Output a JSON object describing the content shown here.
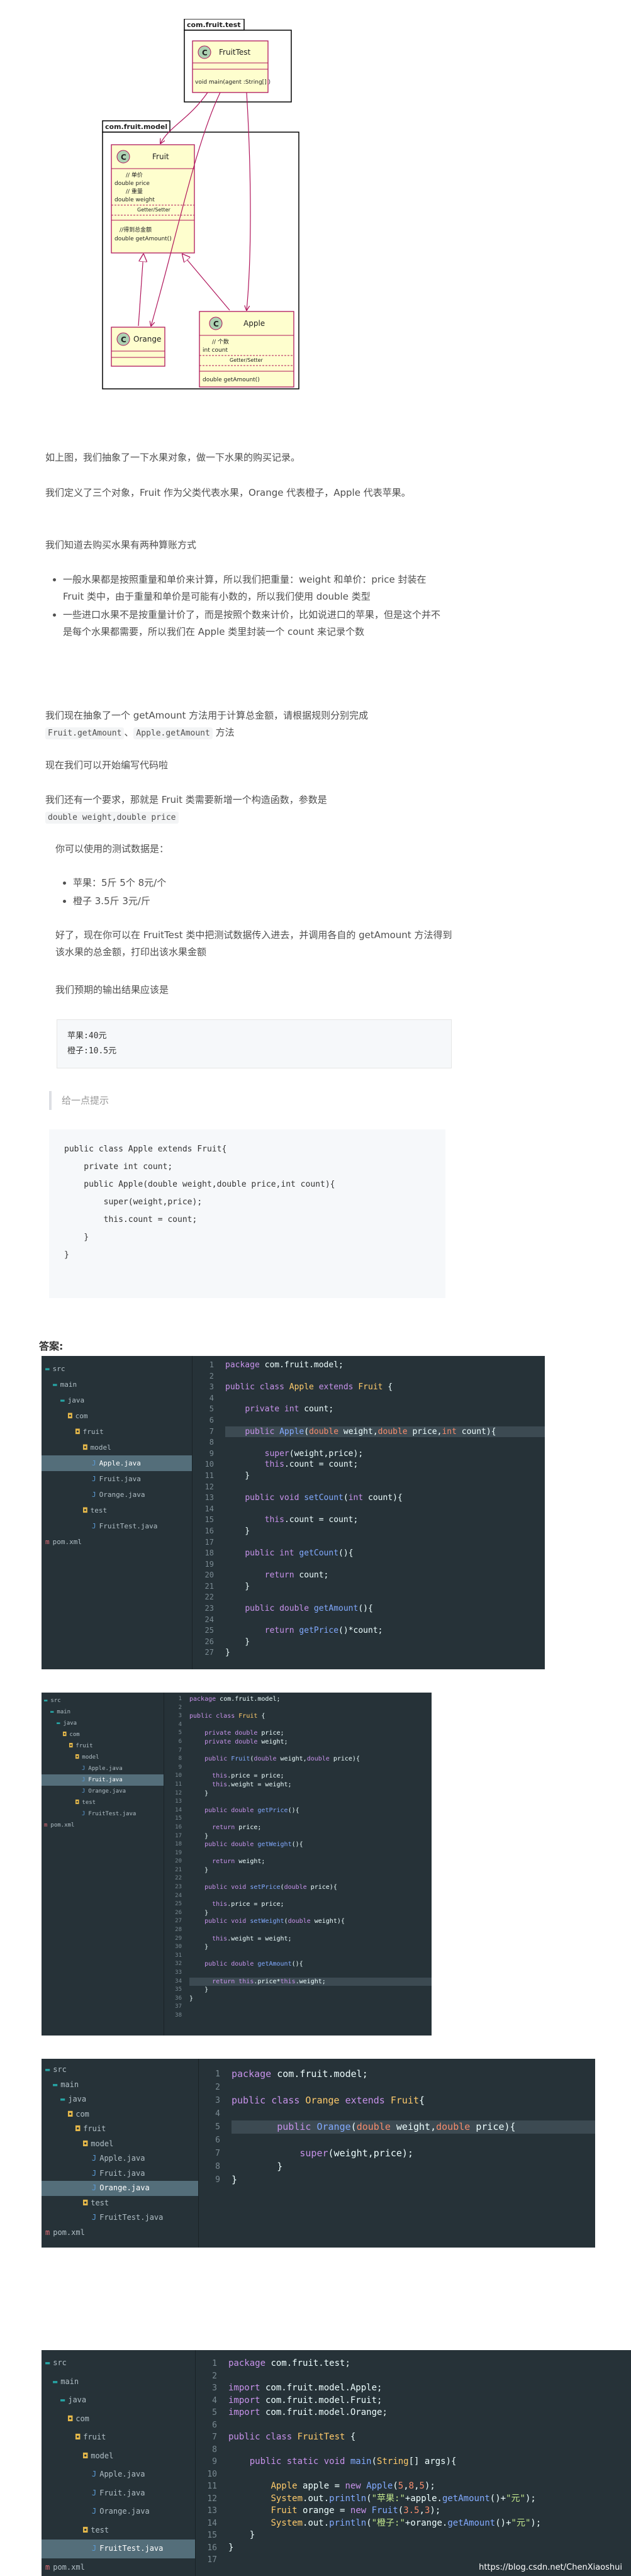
{
  "uml": {
    "pkg_test": "com.fruit.test",
    "pkg_model": "com.fruit.model",
    "fruittest": {
      "name": "FruitTest",
      "method": "void main(agent :String[] )"
    },
    "fruit": {
      "name": "Fruit",
      "field_comment1": "// 单价",
      "field1": "double price",
      "field_comment2": "// 重量",
      "field2": "double weight",
      "getset": "Getter/Setter",
      "method_comment": "//得到总金额",
      "method": "double getAmount()"
    },
    "orange": {
      "name": "Orange"
    },
    "apple": {
      "name": "Apple",
      "field_comment": "// 个数",
      "field": "int count",
      "getset": "Getter/Setter",
      "method": "double getAmount()"
    }
  },
  "article": {
    "p1": "如上图，我们抽象了一下水果对象，做一下水果的购买记录。",
    "p2": "我们定义了三个对象，Fruit 作为父类代表水果，Orange 代表橙子，Apple 代表苹果。",
    "p3": "我们知道去购买水果有两种算账方式",
    "b1": "一般水果都是按照重量和单价来计算，所以我们把重量：weight 和单价：price 封装在 Fruit 类中，由于重量和单价是可能有小数的，所以我们使用 double 类型",
    "b2": "一些进口水果不是按重量计价了，而是按照个数来计价，比如说进口的苹果，但是这个并不是每个水果都需要，所以我们在 Apple 类里封装一个 count 来记录个数",
    "p4_a": "我们现在抽象了一个 getAmount 方法用于计算总金额，请根据规则分别完成",
    "code1": "Fruit.getAmount",
    "p4_dot": "、",
    "code2": "Apple.getAmount",
    "p4_b": "方法",
    "p5": "现在我们可以开始编写代码啦",
    "p6": "我们还有一个要求，那就是 Fruit 类需要新增一个构造函数，参数是",
    "code3": "double weight,double price",
    "p7": "你可以使用的测试数据是：",
    "b3": "苹果：5斤 5个 8元/个",
    "b4": "橙子 3.5斤 3元/斤",
    "p8": "好了，现在你可以在 FruitTest 类中把测试数据传入进去，并调用各自的 getAmount 方法得到该水果的总金额，打印出该水果金额",
    "p9": "我们预期的输出结果应该是",
    "result1": "苹果:40元",
    "result2": "橙子:10.5元",
    "tip": "给一点提示",
    "tipcode": [
      "public class Apple extends Fruit{",
      "",
      "    private int count;",
      "",
      "    public Apple(double weight,double price,int count){",
      "        super(weight,price);",
      "        this.count = count;",
      "    }",
      "}"
    ],
    "answer": "答案:"
  },
  "tree": {
    "src": "src",
    "main": "main",
    "java": "java",
    "com": "com",
    "fruit": "fruit",
    "model": "model",
    "apple": "Apple.java",
    "fruitj": "Fruit.java",
    "orange": "Orange.java",
    "test": "test",
    "fruittest": "FruitTest.java",
    "pom": "pom.xml"
  },
  "watermark": "https://blog.csdn.net/ChenXiaoshui"
}
